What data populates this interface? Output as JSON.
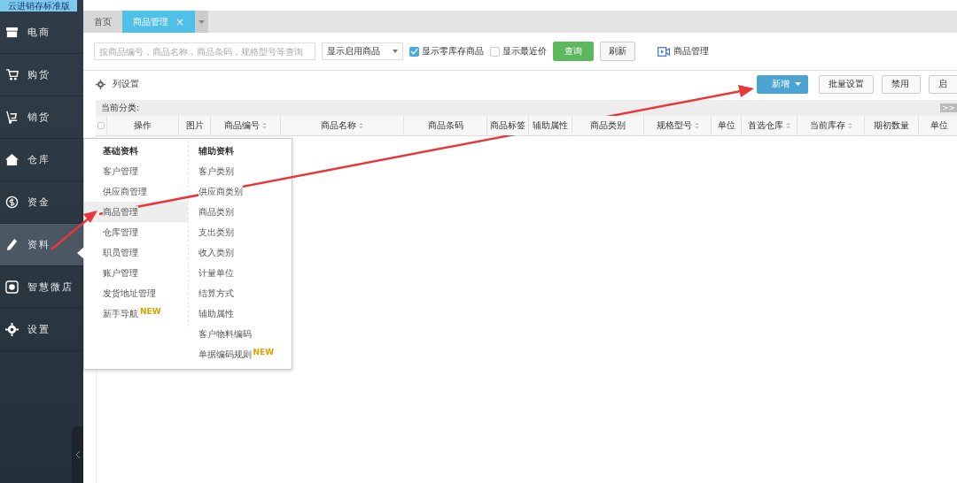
{
  "app": {
    "title": "云进销存标准版"
  },
  "sidebar": {
    "items": [
      {
        "label": "电商",
        "selected": false
      },
      {
        "label": "购货",
        "selected": false
      },
      {
        "label": "销货",
        "selected": false
      },
      {
        "label": "仓库",
        "selected": false
      },
      {
        "label": "资金",
        "selected": false
      },
      {
        "label": "资料",
        "selected": true
      },
      {
        "label": "智慧微店",
        "selected": false
      },
      {
        "label": "设置",
        "selected": false
      }
    ]
  },
  "tabs": [
    {
      "label": "首页",
      "selected": false
    },
    {
      "label": "商品管理",
      "selected": true,
      "close": "×"
    }
  ],
  "toolbar": {
    "search": {
      "placeholder": "按商品编号，商品名称，商品条码，规格型号等查询"
    },
    "filter": {
      "value": "显示启用商品"
    },
    "checkboxes": [
      {
        "label": "显示零库存商品",
        "checked": true
      },
      {
        "label": "显示最近价",
        "checked": false
      }
    ],
    "query_button": "查询",
    "refresh_button": "刷新",
    "help_link": "商品管理"
  },
  "actions": {
    "column_settings": "列设置",
    "buttons": [
      {
        "label": "新增",
        "kind": "primary"
      },
      {
        "label": "批量设置",
        "kind": "plain"
      },
      {
        "label": "禁用",
        "kind": "plain"
      },
      {
        "label": "启",
        "kind": "plain"
      }
    ]
  },
  "category": {
    "label": "当前分类:",
    "expand": ">>"
  },
  "table": {
    "select_all_checked": false,
    "columns": [
      {
        "label": "操作",
        "sortable": false
      },
      {
        "label": "图片",
        "sortable": false
      },
      {
        "label": "商品编号",
        "sortable": true
      },
      {
        "label": "商品名称",
        "sortable": true
      },
      {
        "label": "商品条码",
        "sortable": false
      },
      {
        "label": "商品标签",
        "sortable": false
      },
      {
        "label": "辅助属性",
        "sortable": false
      },
      {
        "label": "商品类别",
        "sortable": false
      },
      {
        "label": "规格型号",
        "sortable": true
      },
      {
        "label": "单位",
        "sortable": false
      },
      {
        "label": "首选仓库",
        "sortable": true
      },
      {
        "label": "当前库存",
        "sortable": true
      },
      {
        "label": "期初数量",
        "sortable": false
      },
      {
        "label": "单位",
        "sortable": false
      }
    ]
  },
  "menu": {
    "groups": [
      {
        "title": "基础资料",
        "items": [
          {
            "label": "客户管理",
            "selected": false
          },
          {
            "label": "供应商管理",
            "selected": false
          },
          {
            "label": "商品管理",
            "selected": true
          },
          {
            "label": "仓库管理",
            "selected": false
          },
          {
            "label": "职员管理",
            "selected": false
          },
          {
            "label": "账户管理",
            "selected": false
          },
          {
            "label": "发货地址管理",
            "selected": false
          },
          {
            "label": "新手导航",
            "selected": false,
            "badge": "NEW"
          }
        ]
      },
      {
        "title": "辅助资料",
        "items": [
          {
            "label": "客户类别",
            "selected": false
          },
          {
            "label": "供应商类别",
            "selected": false
          },
          {
            "label": "商品类别",
            "selected": false
          },
          {
            "label": "支出类别",
            "selected": false
          },
          {
            "label": "收入类别",
            "selected": false
          },
          {
            "label": "计量单位",
            "selected": false
          },
          {
            "label": "结算方式",
            "selected": false
          },
          {
            "label": "辅助属性",
            "selected": false
          },
          {
            "label": "客户物料编码",
            "selected": false
          },
          {
            "label": "单据编码规则",
            "selected": false,
            "badge": "NEW"
          }
        ]
      }
    ]
  }
}
